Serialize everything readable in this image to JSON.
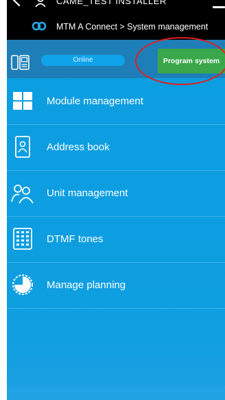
{
  "header": {
    "device_name": "CAME_TEST INSTALLER",
    "breadcrumb": "MTM A Connect > System management"
  },
  "status_bar": {
    "status": "Online",
    "program_button_label": "Program system"
  },
  "menu": {
    "items": [
      {
        "label": "Module management",
        "icon": "grid-icon"
      },
      {
        "label": "Address book",
        "icon": "contact-card-icon"
      },
      {
        "label": "Unit management",
        "icon": "users-icon"
      },
      {
        "label": "DTMF tones",
        "icon": "keypad-icon"
      },
      {
        "label": "Manage planning",
        "icon": "clock-icon"
      }
    ]
  },
  "colors": {
    "header_bg": "#000000",
    "status_bar_bg": "#1e7fb8",
    "main_bg": "#0c9ee0",
    "program_button_bg": "#3aa84a",
    "online_pill_bg": "#0fa3ea",
    "annotation_circle": "#e02020"
  }
}
